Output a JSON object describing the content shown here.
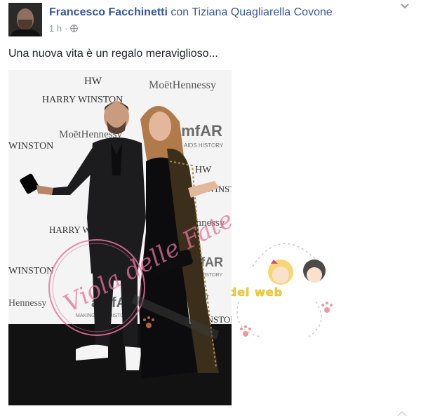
{
  "post": {
    "author": "Francesco Facchinetti",
    "with_word": "con",
    "tagged": "Tiziana Quagliarella Covone",
    "time": "1 h",
    "separator": "·",
    "privacy_icon": "globe-icon",
    "menu_icon": "chevron-down-icon",
    "message": "Una nuova vita è un regalo meraviglioso...",
    "photo": {
      "backdrop_text": [
        "HARRY WINSTON",
        "MoëtHennessy",
        "amfAR",
        "AIDS HISTORY",
        "WINSTON",
        "Hennessy",
        "MAKING AIDS HISTORY",
        "HW"
      ],
      "watermark": "Viola delle Fate",
      "colors": {
        "backdrop": "#f4f4f4",
        "carpet": "#121212",
        "watermark_pink": "#e6719a"
      }
    },
    "overlay_watermark": {
      "text": "la magia del web",
      "color": "#f2cf3c"
    }
  }
}
